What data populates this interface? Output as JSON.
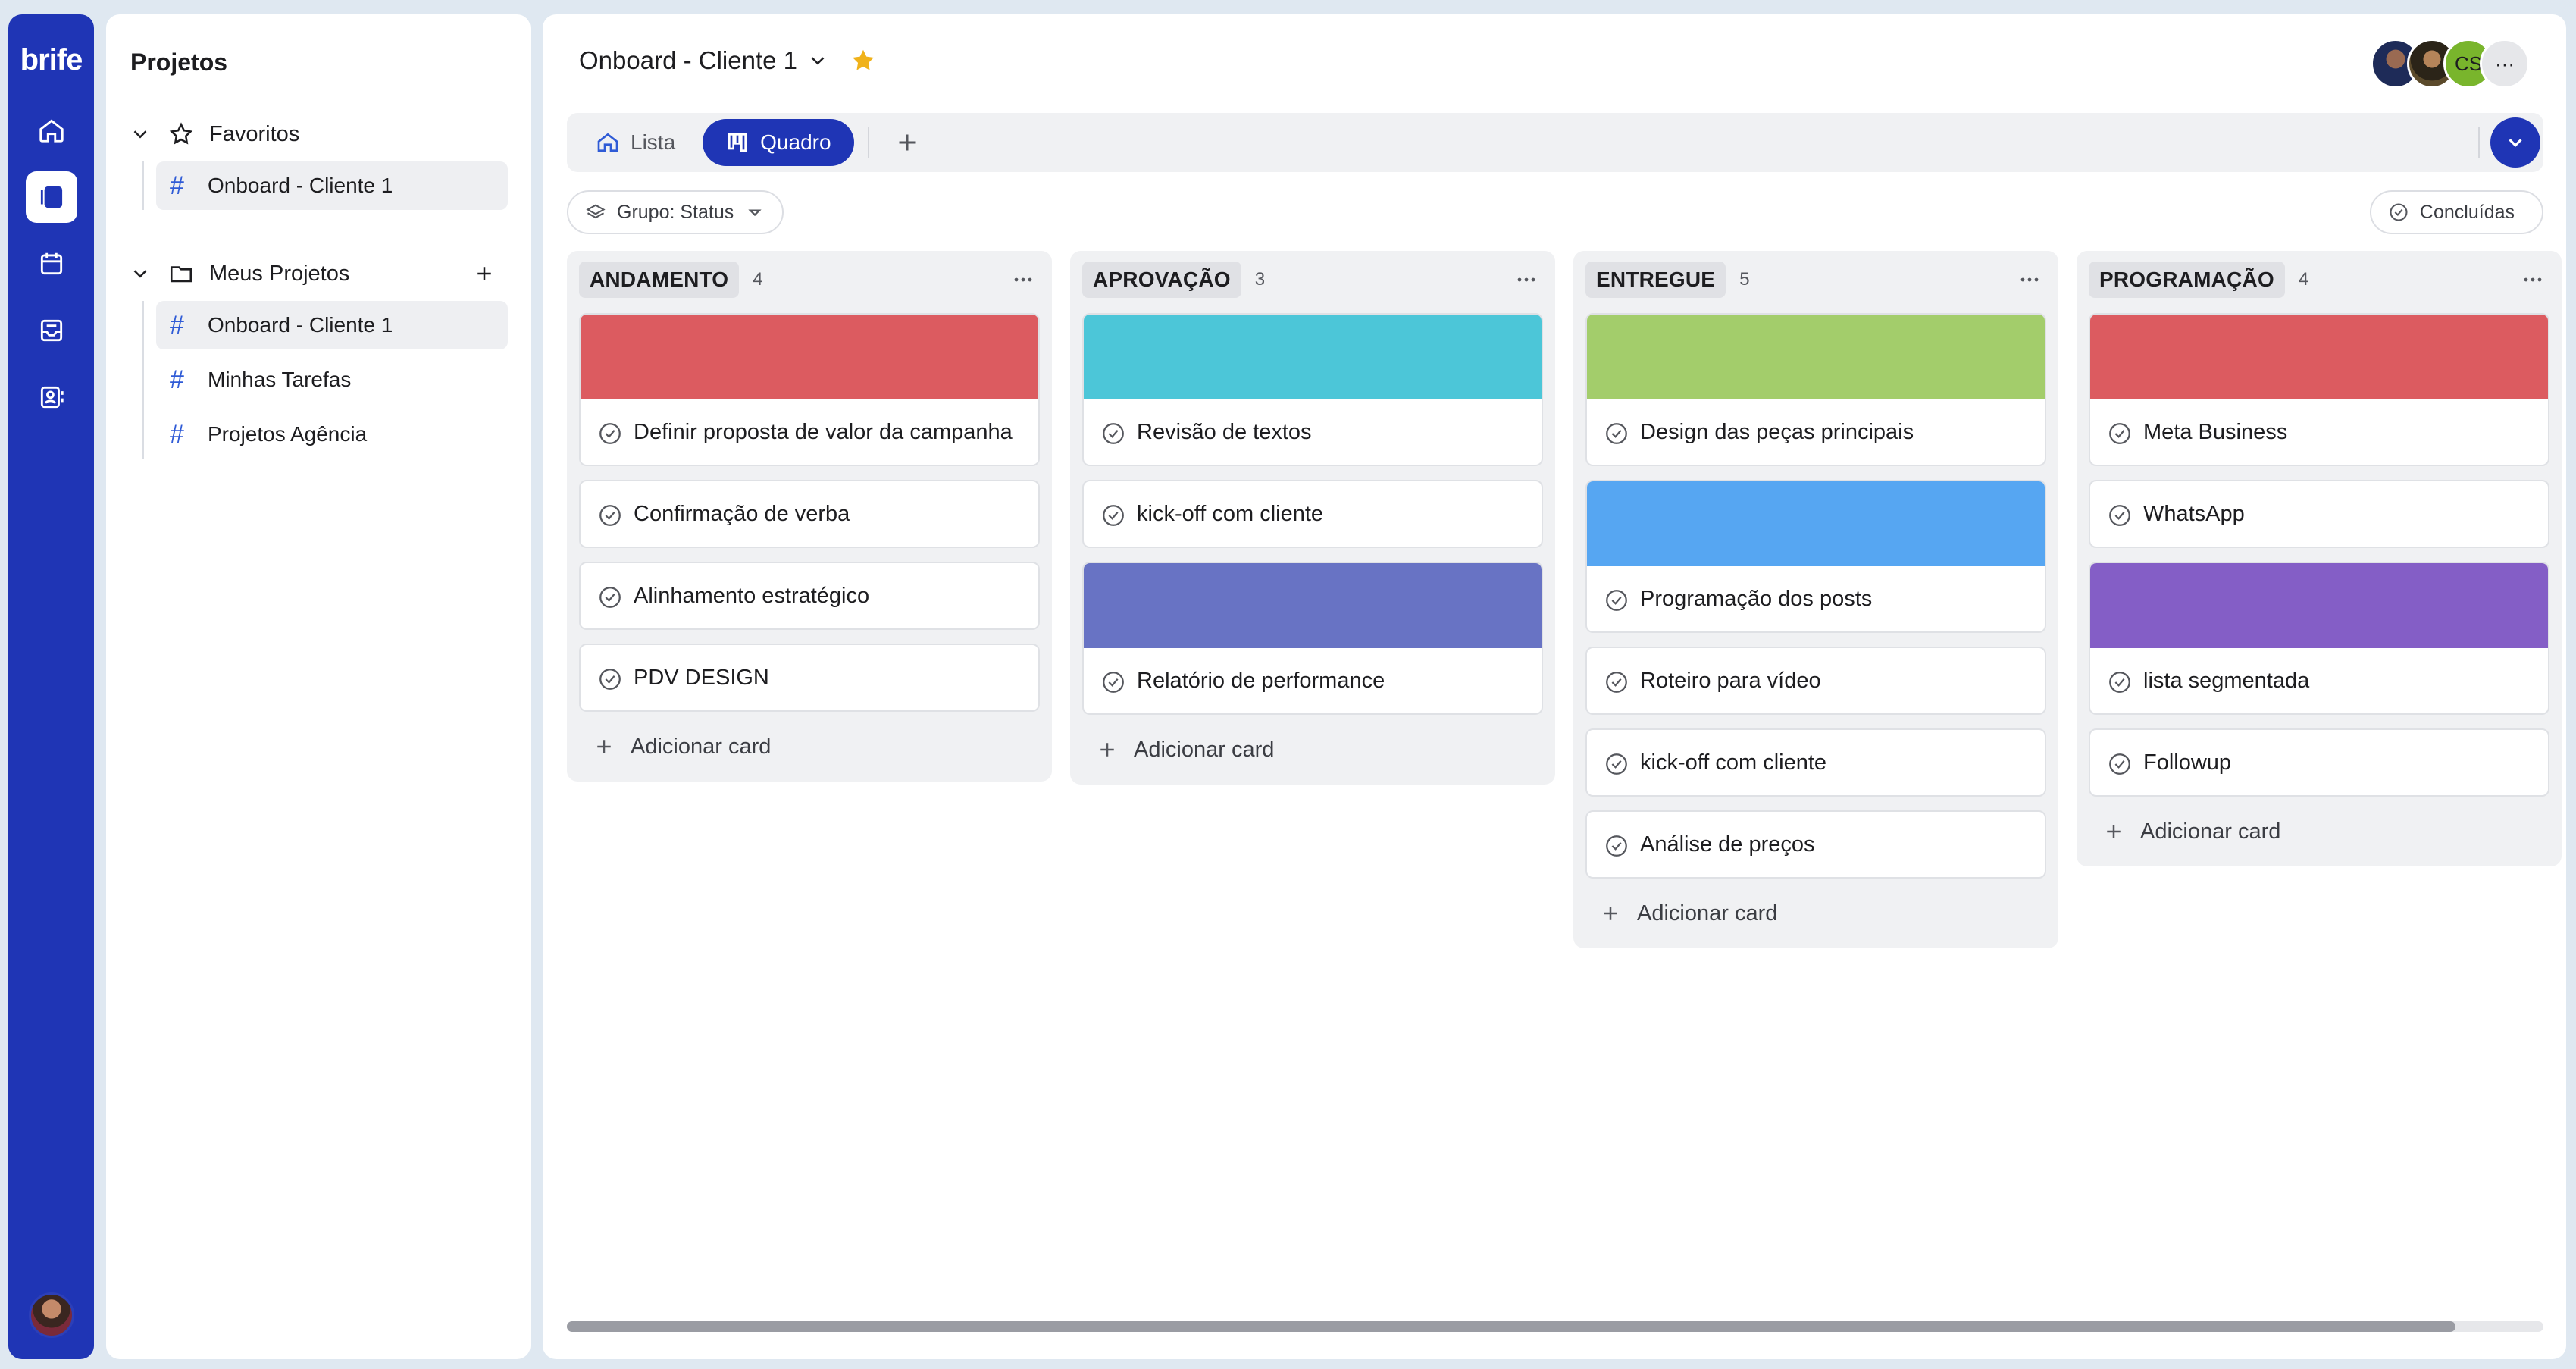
{
  "app": {
    "brand": "brife"
  },
  "rail": {
    "items": [
      {
        "icon": "home-icon"
      },
      {
        "icon": "board-icon",
        "active": true
      },
      {
        "icon": "calendar-icon"
      },
      {
        "icon": "inbox-icon"
      },
      {
        "icon": "contacts-icon"
      }
    ]
  },
  "projects_panel": {
    "title": "Projetos",
    "favorites": {
      "label": "Favoritos",
      "items": [
        "Onboard - Cliente 1"
      ]
    },
    "my_projects": {
      "label": "Meus Projetos",
      "items": [
        "Onboard - Cliente 1",
        "Minhas Tarefas",
        "Projetos Agência"
      ]
    }
  },
  "header": {
    "title": "Onboard - Cliente 1",
    "avatar_initials": "CS",
    "more": "···"
  },
  "tabs": {
    "list": "Lista",
    "board": "Quadro"
  },
  "filters": {
    "group": "Grupo: Status",
    "done": "Concluídas"
  },
  "board": {
    "add_card_label": "Adicionar card",
    "columns": [
      {
        "name": "ANDAMENTO",
        "count": "4",
        "cards": [
          {
            "title": "Definir proposta de valor da campanha",
            "cover": "#dc5b60"
          },
          {
            "title": "Confirmação de verba"
          },
          {
            "title": "Alinhamento estratégico"
          },
          {
            "title": "PDV DESIGN"
          }
        ]
      },
      {
        "name": "APROVAÇÃO",
        "count": "3",
        "cards": [
          {
            "title": "Revisão de textos",
            "cover": "#4cc6d8"
          },
          {
            "title": "kick-off com cliente"
          },
          {
            "title": "Relatório de performance",
            "cover": "#6873c4"
          }
        ]
      },
      {
        "name": "ENTREGUE",
        "count": "5",
        "cards": [
          {
            "title": "Design das peças principais",
            "cover": "#a3cd6b"
          },
          {
            "title": "Programação dos posts",
            "cover": "#56a6f2"
          },
          {
            "title": "Roteiro para vídeo"
          },
          {
            "title": "kick-off com cliente"
          },
          {
            "title": "Análise de preços"
          }
        ]
      },
      {
        "name": "PROGRAMAÇÃO",
        "count": "4",
        "cards": [
          {
            "title": "Meta Business",
            "cover": "#dc5b60"
          },
          {
            "title": "WhatsApp"
          },
          {
            "title": "lista segmentada",
            "cover": "#845ec6"
          },
          {
            "title": "Followup"
          }
        ]
      }
    ]
  },
  "colors": {
    "primary": "#1f35b5",
    "favorite_star": "#f0b21a",
    "hash": "#2f5bd6"
  }
}
